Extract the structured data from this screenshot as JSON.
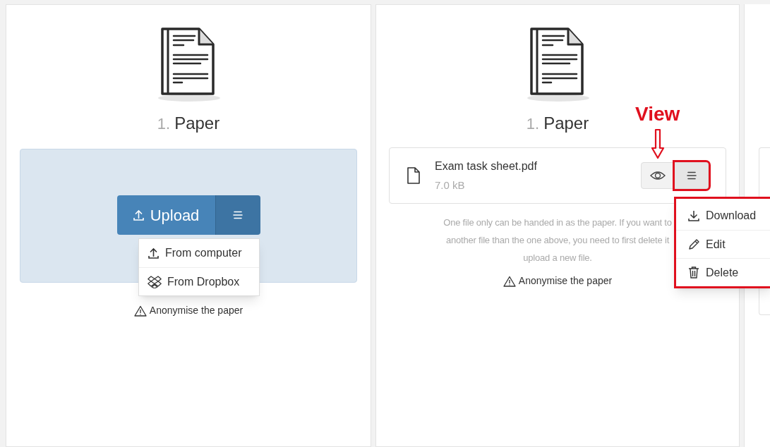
{
  "panels": [
    {
      "kind": "upload",
      "number": "1.",
      "title": "Paper",
      "upload": {
        "label": "Upload",
        "menu_open": true,
        "menu": [
          {
            "label": "From computer"
          },
          {
            "label": "From Dropbox"
          }
        ]
      },
      "anonymise": "Anonymise the paper"
    },
    {
      "kind": "file",
      "number": "1.",
      "title": "Paper",
      "file": {
        "name": "Exam task sheet.pdf",
        "size": "7.0 kB",
        "menu_open": true,
        "menu": [
          {
            "label": "Download"
          },
          {
            "label": "Edit"
          },
          {
            "label": "Delete"
          }
        ]
      },
      "note_lines": [
        "One file only can be handed in as the paper. If you want to",
        "another file than the one above, you need to first delete it",
        "upload a new file."
      ],
      "anonymise": "Anonymise the paper"
    },
    {
      "kind": "partial"
    }
  ],
  "annotation": {
    "label": "View"
  }
}
